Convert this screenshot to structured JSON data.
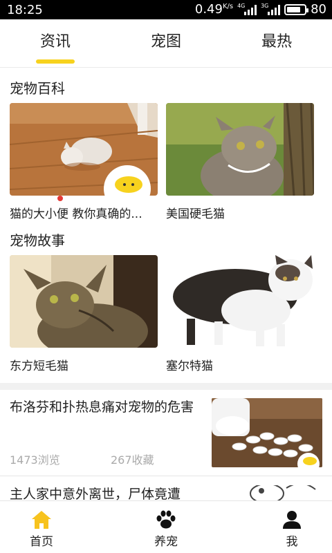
{
  "status_bar": {
    "time": "18:25",
    "speed": "0.49",
    "speed_unit": "K/s",
    "net1": "4G",
    "net2": "3G",
    "battery": "80",
    "battery_level": 0.8
  },
  "tabs": [
    {
      "label": "资讯",
      "active": true
    },
    {
      "label": "宠图",
      "active": false
    },
    {
      "label": "最热",
      "active": false
    }
  ],
  "accent_color": "#f7d21e",
  "sections": [
    {
      "title": "宠物百科",
      "items": [
        {
          "caption": "猫的大小便  教你真确的...",
          "image": "white-cat-on-floor"
        },
        {
          "caption": "美国硬毛猫",
          "image": "tabby-cat-by-tree"
        }
      ]
    },
    {
      "title": "宠物故事",
      "items": [
        {
          "caption": "东方短毛猫",
          "image": "oriental-shorthair-cat"
        },
        {
          "caption": "塞尔特猫",
          "image": "white-black-cat-standing"
        }
      ]
    }
  ],
  "articles": [
    {
      "title": "布洛芬和扑热息痛对宠物的危害",
      "views": "1473浏览",
      "favs": "267收藏",
      "image": "white-pills"
    },
    {
      "title": "主人家中意外离世，尸体竟遭",
      "image": "cartoon-cat"
    }
  ],
  "bottom_nav": [
    {
      "label": "首页",
      "icon": "home-icon",
      "active": true
    },
    {
      "label": "养宠",
      "icon": "paw-icon",
      "active": false
    },
    {
      "label": "我",
      "icon": "user-icon",
      "active": false
    }
  ]
}
